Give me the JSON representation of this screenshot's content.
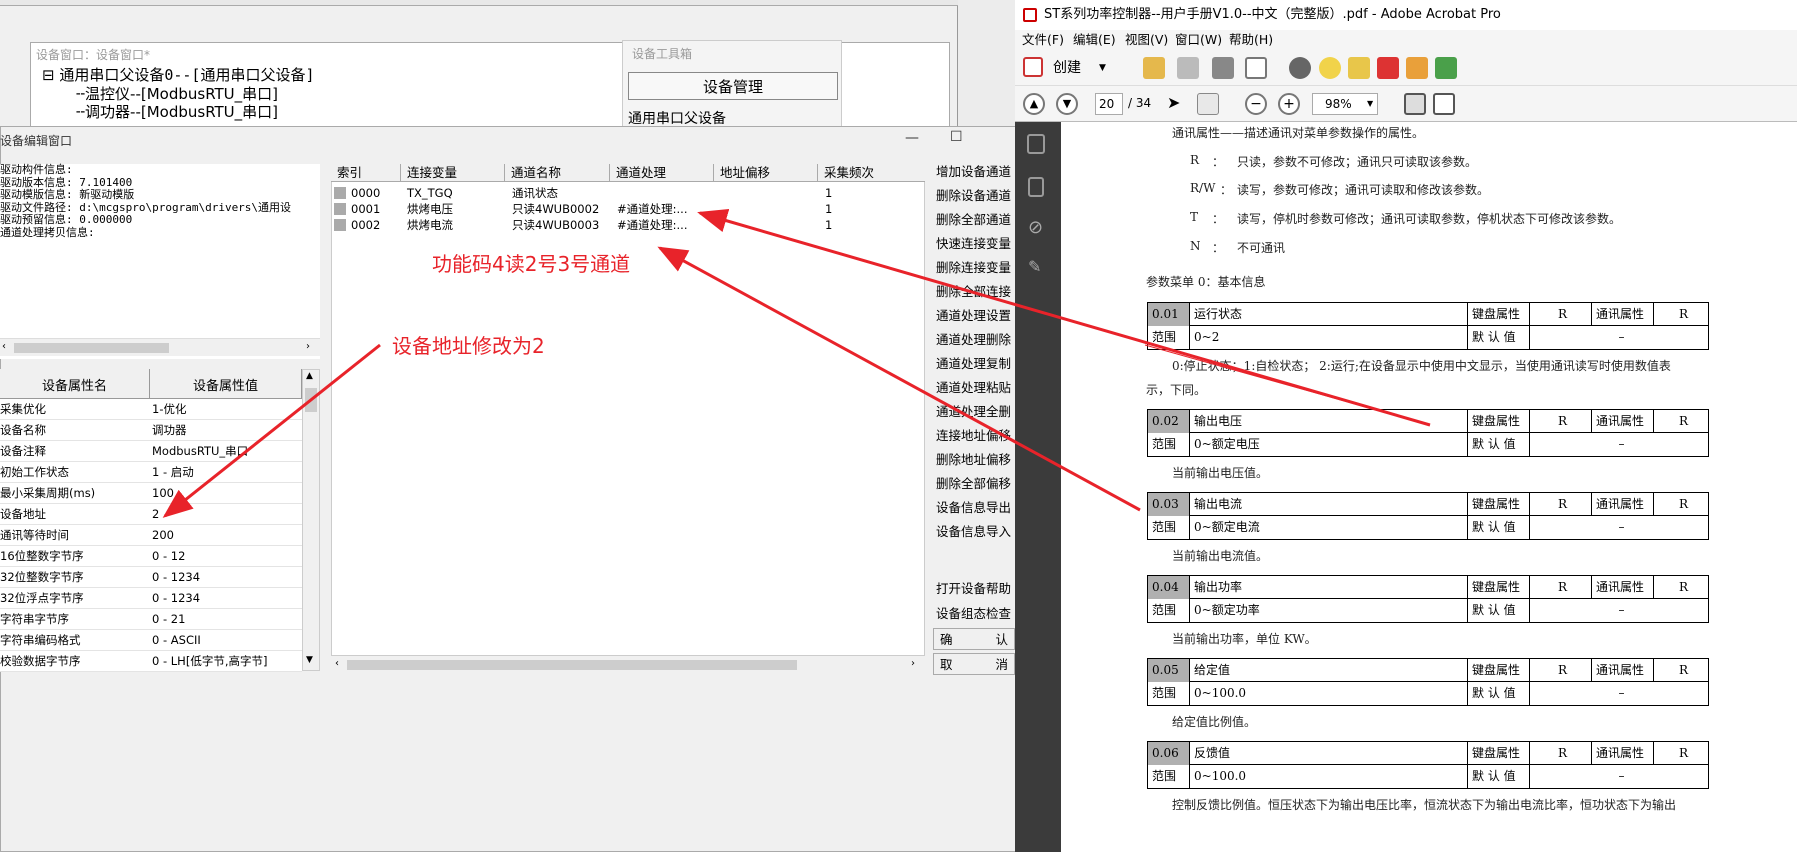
{
  "bg_window": {
    "device_window_title": "设备窗口：设备窗口*",
    "tree": [
      "通用串口父设备0--[通用串口父设备]",
      "温控仪--[ModbusRTU_串口]",
      "调功器--[ModbusRTU_串口]"
    ],
    "toolbox_title": "设备工具箱",
    "toolbox_button": "设备管理",
    "toolbox_item": "通用串口父设备"
  },
  "editor": {
    "title": "设备编辑窗口",
    "minimize": "—",
    "maximize": "☐",
    "info_lines": [
      "驱动构件信息:",
      "驱动版本信息: 7.101400",
      "驱动模版信息: 新驱动模版",
      "驱动文件路径: d:\\mcgspro\\program\\drivers\\通用设",
      "驱动预留信息: 0.000000",
      "通道处理拷贝信息:"
    ],
    "prop_headers": [
      "设备属性名",
      "设备属性值"
    ],
    "props": [
      [
        "采集优化",
        "1-优化"
      ],
      [
        "设备名称",
        "调功器"
      ],
      [
        "设备注释",
        "ModbusRTU_串口"
      ],
      [
        "初始工作状态",
        "1 - 启动"
      ],
      [
        "最小采集周期(ms)",
        "100"
      ],
      [
        "设备地址",
        "2"
      ],
      [
        "通讯等待时间",
        "200"
      ],
      [
        "16位整数字节序",
        "0 - 12"
      ],
      [
        "32位整数字节序",
        "0 - 1234"
      ],
      [
        "32位浮点字节序",
        "0 - 1234"
      ],
      [
        "字符串字节序",
        "0 - 21"
      ],
      [
        "字符串编码格式",
        "0 - ASCII"
      ],
      [
        "校验数据字节序",
        "0 - LH[低字节,高字节]"
      ]
    ],
    "chan_headers": [
      "索引",
      "连接变量",
      "通道名称",
      "通道处理",
      "地址偏移",
      "采集频次"
    ],
    "chan_rows": [
      [
        "0000",
        "TX_TGQ",
        "通讯状态",
        "",
        "",
        "1"
      ],
      [
        "0001",
        "烘烤电压",
        "只读4WUB0002",
        "#通道处理:...",
        "",
        "1"
      ],
      [
        "0002",
        "烘烤电流",
        "只读4WUB0003",
        "#通道处理:...",
        "",
        "1"
      ]
    ],
    "right_buttons": [
      "增加设备通道",
      "删除设备通道",
      "删除全部通道",
      "快速连接变量",
      "删除连接变量",
      "删除全部连接",
      "通道处理设置",
      "通道处理删除",
      "通道处理复制",
      "通道处理粘贴",
      "通道处理全删",
      "连接地址偏移",
      "删除地址偏移",
      "删除全部偏移",
      "设备信息导出",
      "设备信息导入"
    ],
    "bottom_buttons": [
      "打开设备帮助",
      "设备组态检查"
    ],
    "confirm": [
      "确",
      "认"
    ],
    "cancel": [
      "取",
      "消"
    ]
  },
  "annotations": {
    "func_code": "功能码4读2号3号通道",
    "addr_change": "设备地址修改为2",
    "color": "#e8232a"
  },
  "acrobat": {
    "title": "ST系列功率控制器--用户手册V1.0--中文（完整版）.pdf - Adobe Acrobat Pro",
    "menu": [
      "文件(F)",
      "编辑(E)",
      "视图(V)",
      "窗口(W)",
      "帮助(H)"
    ],
    "create": "创建",
    "page_current": "20",
    "page_total": "/ 34",
    "zoom": "98%",
    "page": {
      "intro": "通讯属性——描述通讯对菜单参数操作的属性。",
      "legend": [
        [
          "R",
          "只读，参数不可修改；通讯只可读取该参数。"
        ],
        [
          "R/W",
          "读写，参数可修改；通讯可读取和修改该参数。"
        ],
        [
          "T",
          "读写，停机时参数可修改；通讯可读取参数，停机状态下可修改该参数。"
        ],
        [
          "N",
          "不可通讯"
        ]
      ],
      "menu_title": "参数菜单 0：基本信息",
      "kb_label": "键盘属性",
      "comm_label": "通讯属性",
      "range_label": "范围",
      "default_label": "默 认 值",
      "params": [
        {
          "code": "0.01",
          "name": "运行状态",
          "kb": "R",
          "comm": "R",
          "range": "0~2",
          "default": "–",
          "desc": "0:停止状态；1:自检状态； 2:运行;在设备显示中使用中文显示，当使用通讯读写时使用数值表",
          "desc2": "示，下同。"
        },
        {
          "code": "0.02",
          "name": "输出电压",
          "kb": "R",
          "comm": "R",
          "range": "0~额定电压",
          "default": "–",
          "desc": "当前输出电压值。"
        },
        {
          "code": "0.03",
          "name": "输出电流",
          "kb": "R",
          "comm": "R",
          "range": "0~额定电流",
          "default": "–",
          "desc": "当前输出电流值。"
        },
        {
          "code": "0.04",
          "name": "输出功率",
          "kb": "R",
          "comm": "R",
          "range": "0~额定功率",
          "default": "–",
          "desc": "当前输出功率，单位 KW。"
        },
        {
          "code": "0.05",
          "name": "给定值",
          "kb": "R",
          "comm": "R",
          "range": "0~100.0",
          "default": "–",
          "desc": "给定值比例值。"
        },
        {
          "code": "0.06",
          "name": "反馈值",
          "kb": "R",
          "comm": "R",
          "range": "0~100.0",
          "default": "–",
          "desc": "控制反馈比例值。恒压状态下为输出电压比率，恒流状态下为输出电流比率，恒功状态下为输出"
        }
      ]
    }
  }
}
